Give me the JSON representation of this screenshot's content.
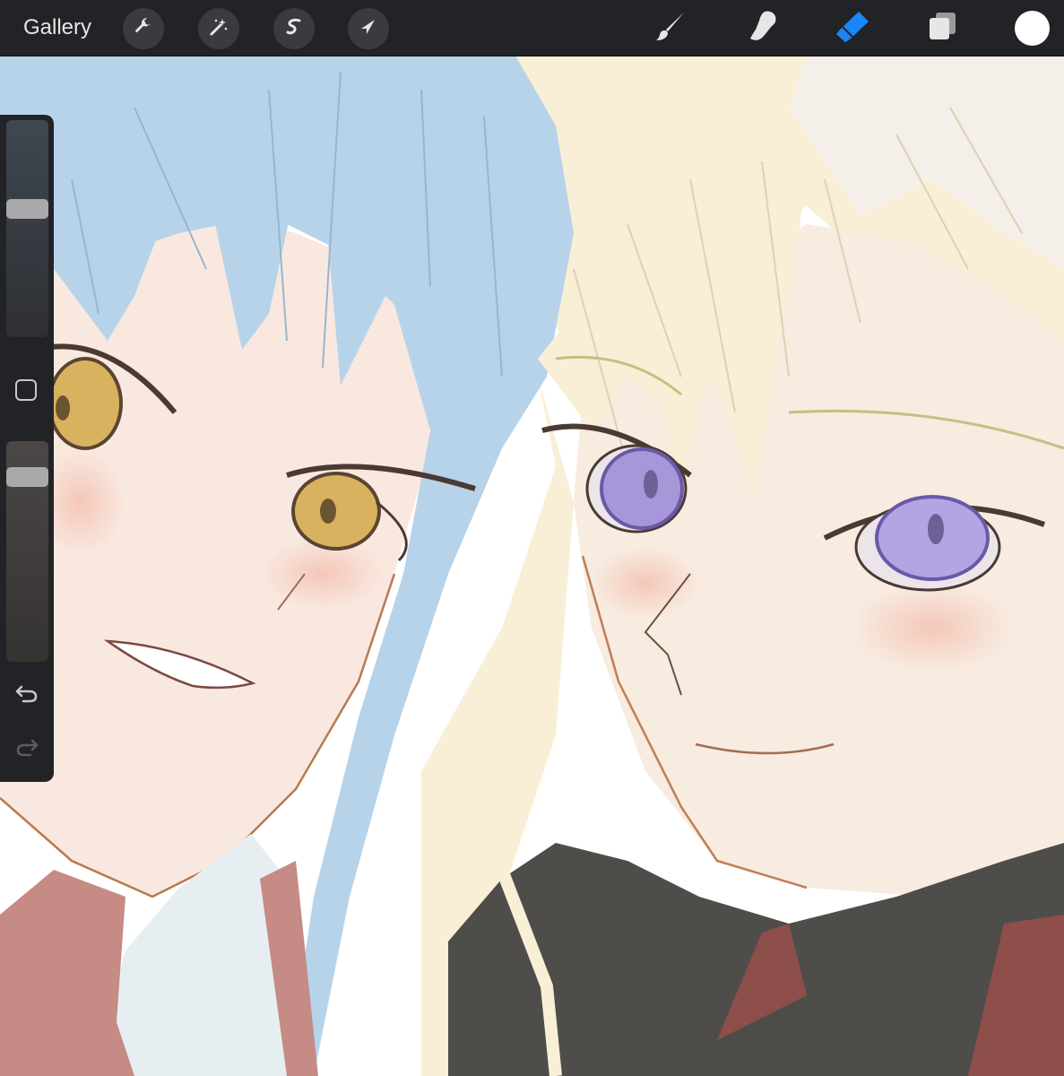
{
  "app": {
    "gallery_label": "Gallery"
  },
  "toolbar_left": [
    {
      "name": "actions",
      "icon": "wrench-icon"
    },
    {
      "name": "adjustments",
      "icon": "magic-wand-icon"
    },
    {
      "name": "selection",
      "icon": "selection-s-icon"
    },
    {
      "name": "transform",
      "icon": "arrow-cursor-icon"
    }
  ],
  "toolbar_right": [
    {
      "name": "brush",
      "icon": "brush-icon",
      "active": false
    },
    {
      "name": "smudge",
      "icon": "smudge-finger-icon",
      "active": false
    },
    {
      "name": "eraser",
      "icon": "eraser-icon",
      "active": true
    },
    {
      "name": "layers",
      "icon": "layers-icon",
      "active": false
    }
  ],
  "current_color": "#ffffff",
  "accent_color": "#1a86f5",
  "sidebar": {
    "brush_size_level": 0.6,
    "opacity_level": 0.87,
    "undo_icon": "undo-arrow-icon",
    "redo_icon": "redo-arrow-icon",
    "modify_icon": "square-modify-icon"
  }
}
